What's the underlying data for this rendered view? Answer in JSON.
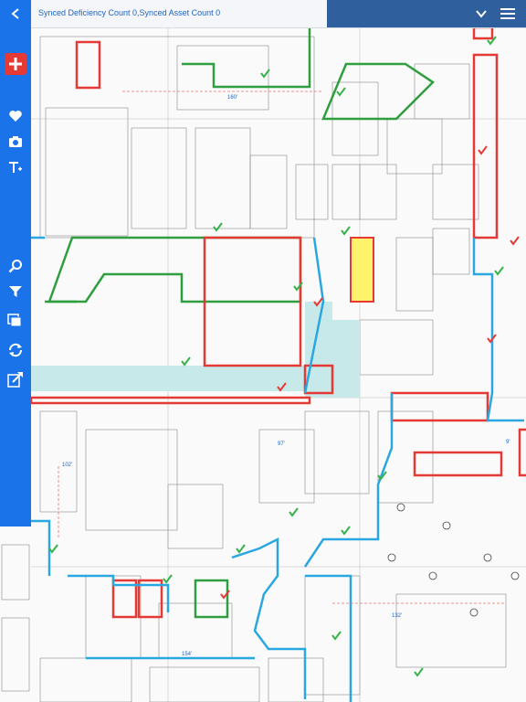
{
  "status": {
    "synced_text": "Synced Deficiency Count 0,Synced Asset Count 0"
  },
  "toolbar": {
    "back": "back",
    "add": "add",
    "favorite": "favorite",
    "camera": "camera",
    "text": "text",
    "search": "search",
    "filter": "filter",
    "layers": "layers",
    "sync": "sync",
    "share": "share"
  },
  "plan": {
    "corridor_labels": [
      "160'",
      "154'",
      "132'",
      "102'",
      "9'",
      "97'"
    ]
  },
  "colors": {
    "sidebar": "#1a73e8",
    "menu": "#2f5f9c",
    "red_zone": "#e53935",
    "green_zone": "#2e9e3e",
    "blue_zone": "#2aa7e0",
    "yellow_room": "#fff36b",
    "teal_corridor": "#c8e9ea"
  }
}
